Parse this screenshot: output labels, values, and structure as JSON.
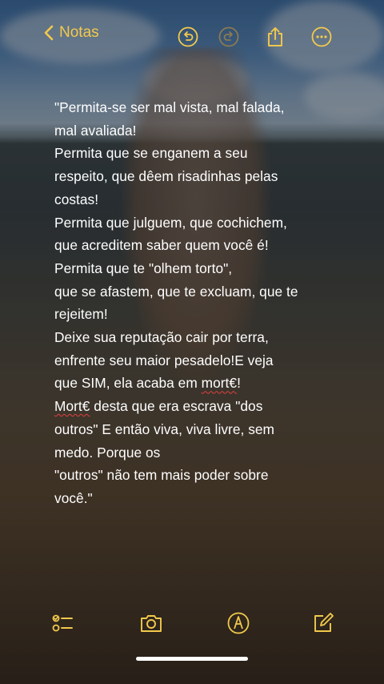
{
  "colors": {
    "accent": "#f2c94c",
    "text": "#ffffff"
  },
  "topbar": {
    "back_label": "Notas",
    "icons": [
      "chevron-left-icon",
      "undo-icon",
      "redo-icon",
      "share-icon",
      "more-icon"
    ]
  },
  "note": {
    "lines": [
      "\"Permita-se ser mal vista, mal falada,",
      "mal avaliada!",
      "Permita que se enganem a seu",
      "respeito, que dêem risadinhas pelas",
      "costas!",
      "Permita que julguem, que cochichem,",
      "que acreditem saber quem você é!",
      "Permita que te \"olhem torto\",",
      "que se afastem, que te excluam, que te",
      "rejeitem!",
      "Deixe sua reputação cair por terra,",
      "enfrente seu maior pesadelo!E veja",
      "que SIM, ela acaba em",
      "mort€",
      "!",
      "Mort€",
      " desta que era escrava \"dos",
      "outros\" E então viva, viva livre, sem",
      "medo. Porque os",
      "\"outros\" não tem mais poder sobre",
      "você.\""
    ]
  },
  "bottombar": {
    "icons": [
      "checklist-icon",
      "camera-icon",
      "markup-pen-icon",
      "compose-icon"
    ]
  }
}
